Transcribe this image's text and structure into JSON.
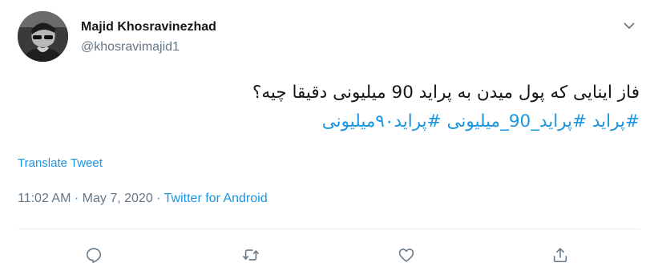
{
  "user": {
    "display_name": "Majid Khosravinezhad",
    "handle": "@khosravimajid1"
  },
  "tweet": {
    "text_line1": "فاز اینایی که پول میدن به پراید 90 میلیونی دقیقا چیه؟",
    "hashtags": [
      "#پراید",
      "#پراید_90_میلیونی",
      "#پراید۹۰میلیونی"
    ]
  },
  "translate_label": "Translate Tweet",
  "meta": {
    "time": "11:02 AM",
    "separator": "·",
    "date": "May 7, 2020",
    "source": "Twitter for Android"
  },
  "icons": {
    "more": "chevron-down-icon",
    "reply": "reply-icon",
    "retweet": "retweet-icon",
    "like": "heart-icon",
    "share": "share-icon"
  },
  "colors": {
    "link": "#1b95e0",
    "text": "#14171a",
    "muted": "#657786",
    "icon": "#657786"
  }
}
